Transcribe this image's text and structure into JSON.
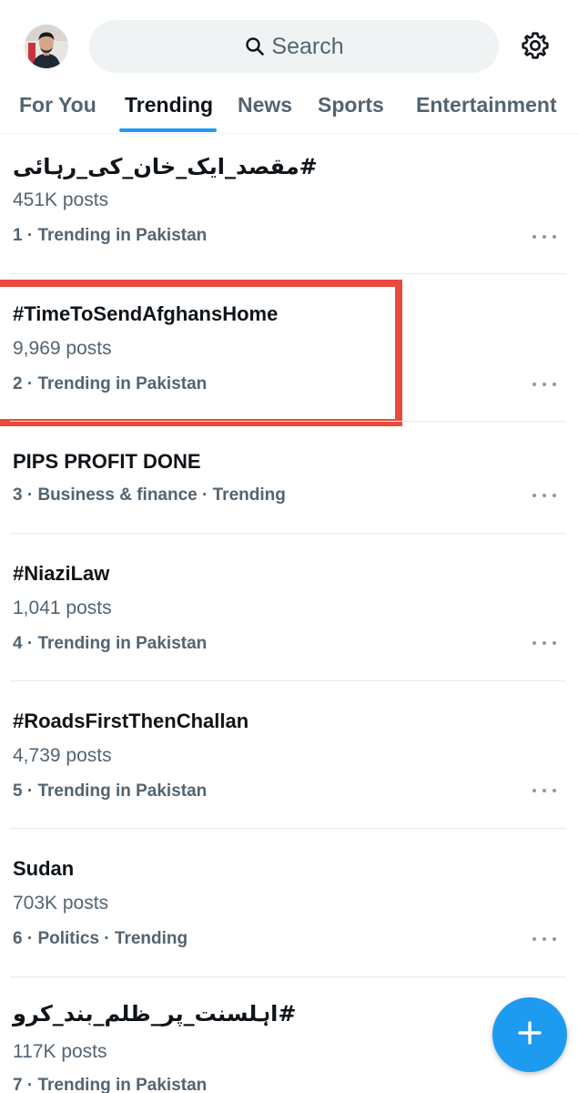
{
  "search": {
    "placeholder": "Search"
  },
  "tabs": [
    {
      "label": "For You",
      "active": false
    },
    {
      "label": "Trending",
      "active": true
    },
    {
      "label": "News",
      "active": false
    },
    {
      "label": "Sports",
      "active": false
    },
    {
      "label": "Entertainment",
      "active": false
    }
  ],
  "trends": [
    {
      "title": "#مقصد_ایک_خان_کی_رہائی",
      "posts": "451K posts",
      "meta": "1 · Trending in Pakistan"
    },
    {
      "title": "#TimeToSendAfghansHome",
      "posts": "9,969 posts",
      "meta": "2 · Trending in Pakistan",
      "highlighted": true
    },
    {
      "title": "PIPS PROFIT DONE",
      "posts": "",
      "meta": "3 · Business & finance · Trending"
    },
    {
      "title": "#NiaziLaw",
      "posts": "1,041 posts",
      "meta": "4 · Trending in Pakistan"
    },
    {
      "title": "#RoadsFirstThenChallan",
      "posts": "4,739 posts",
      "meta": "5 · Trending in Pakistan"
    },
    {
      "title": "Sudan",
      "posts": "703K posts",
      "meta": "6 · Politics · Trending"
    },
    {
      "title": "#اہلسنت_پر_ظلم_بند_کرو",
      "posts": "117K posts",
      "meta": "7 · Trending in Pakistan"
    }
  ],
  "colors": {
    "accent": "#1d9bf0",
    "highlight_border": "#e84a3c",
    "secondary_text": "#536471"
  },
  "icons": {
    "search": "search-icon",
    "settings": "gear-icon",
    "more": "more-horizontal-icon",
    "compose": "plus-icon"
  }
}
